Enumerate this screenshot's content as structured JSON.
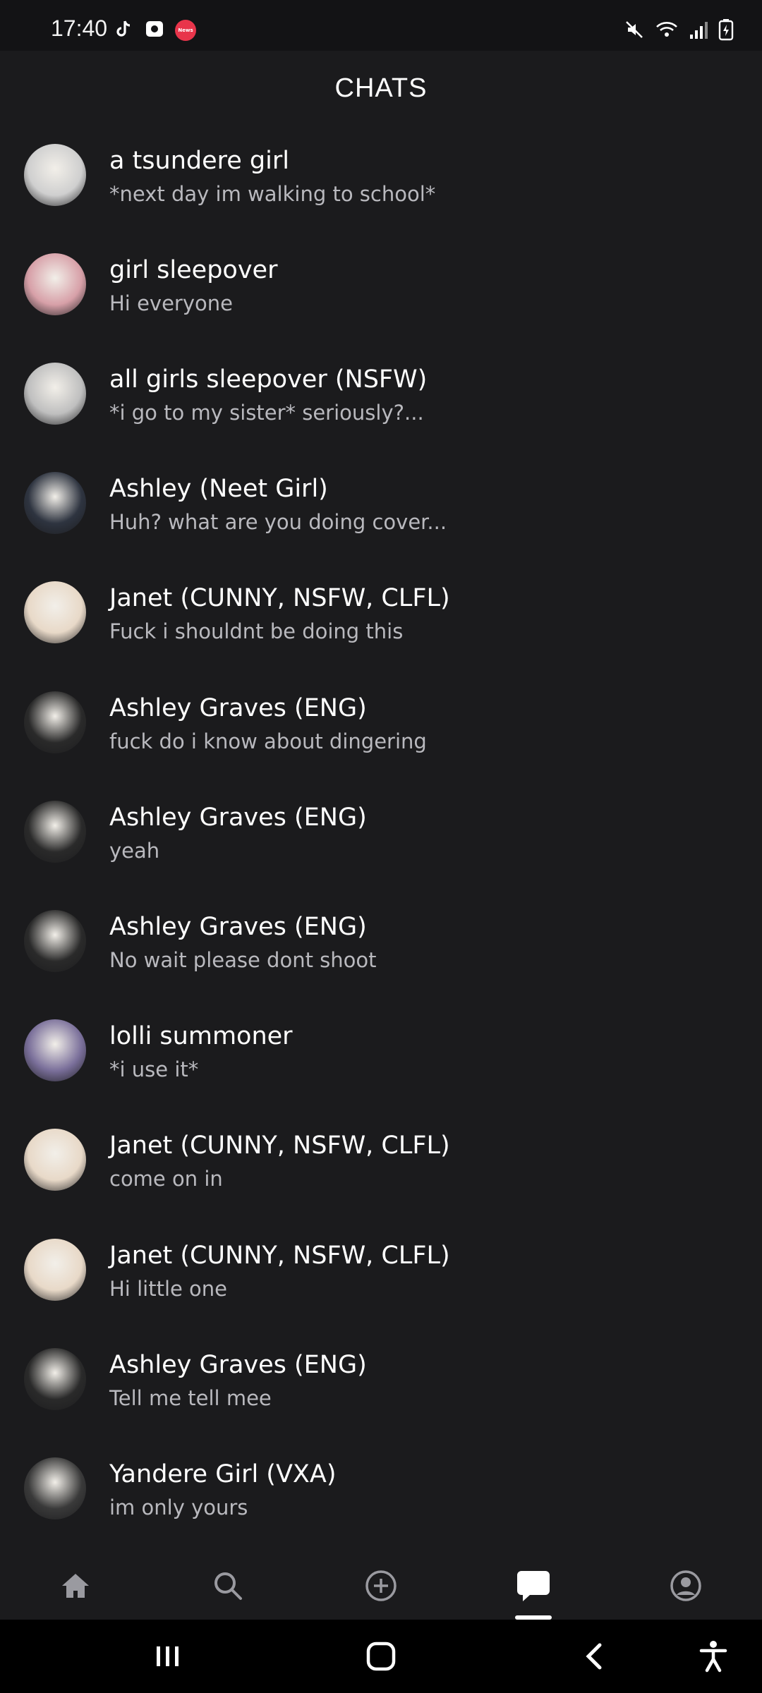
{
  "status_bar": {
    "time": "17:40",
    "app_icons": [
      "tiktok-icon",
      "camera-app-icon",
      "news-icon"
    ],
    "news_label": "News",
    "right_icons": [
      "mute-icon",
      "wifi-icon",
      "signal-icon",
      "battery-charging-icon"
    ]
  },
  "header": {
    "title": "CHATS"
  },
  "chats": [
    {
      "name": "a tsundere girl",
      "preview": "*next day im walking to school*",
      "avatar_color": "#cfcfcf"
    },
    {
      "name": "girl sleepover",
      "preview": "Hi everyone",
      "avatar_color": "#d7a0a8"
    },
    {
      "name": "all girls sleepover (NSFW)",
      "preview": "*i go to my sister* seriously?...",
      "avatar_color": "#bfbfbf"
    },
    {
      "name": "Ashley (Neet Girl)",
      "preview": "Huh? what are you doing cover...",
      "avatar_color": "#2e3440"
    },
    {
      "name": "Janet (CUNNY, NSFW, CLFL)",
      "preview": "Fuck i shouldnt be doing this",
      "avatar_color": "#e8d9c8"
    },
    {
      "name": "Ashley Graves (ENG)",
      "preview": "fuck do i know about dingering",
      "avatar_color": "#2a2a2a"
    },
    {
      "name": "Ashley Graves (ENG)",
      "preview": "yeah",
      "avatar_color": "#2a2a2a"
    },
    {
      "name": "Ashley Graves (ENG)",
      "preview": "No wait please dont shoot",
      "avatar_color": "#2a2a2a"
    },
    {
      "name": "lolli summoner",
      "preview": "*i use it*",
      "avatar_color": "#7a6f9a"
    },
    {
      "name": "Janet (CUNNY, NSFW, CLFL)",
      "preview": "come on in",
      "avatar_color": "#e8d9c8"
    },
    {
      "name": "Janet (CUNNY, NSFW, CLFL)",
      "preview": "Hi little one",
      "avatar_color": "#e8d9c8"
    },
    {
      "name": "Ashley Graves (ENG)",
      "preview": "Tell me tell mee",
      "avatar_color": "#2a2a2a"
    },
    {
      "name": "Yandere Girl (VXA)",
      "preview": "im only yours",
      "avatar_color": "#3a3a3a"
    }
  ],
  "bottom_nav": {
    "items": [
      "home-icon",
      "search-icon",
      "create-icon",
      "chats-icon",
      "profile-icon"
    ],
    "active": "chats-icon"
  },
  "system_nav": [
    "recent-apps-icon",
    "home-button-icon",
    "back-icon",
    "accessibility-icon"
  ],
  "colors": {
    "background": "#1b1b1d",
    "text_primary": "#ffffff",
    "text_secondary": "#b9b9be",
    "news_badge": "#e8354b"
  }
}
